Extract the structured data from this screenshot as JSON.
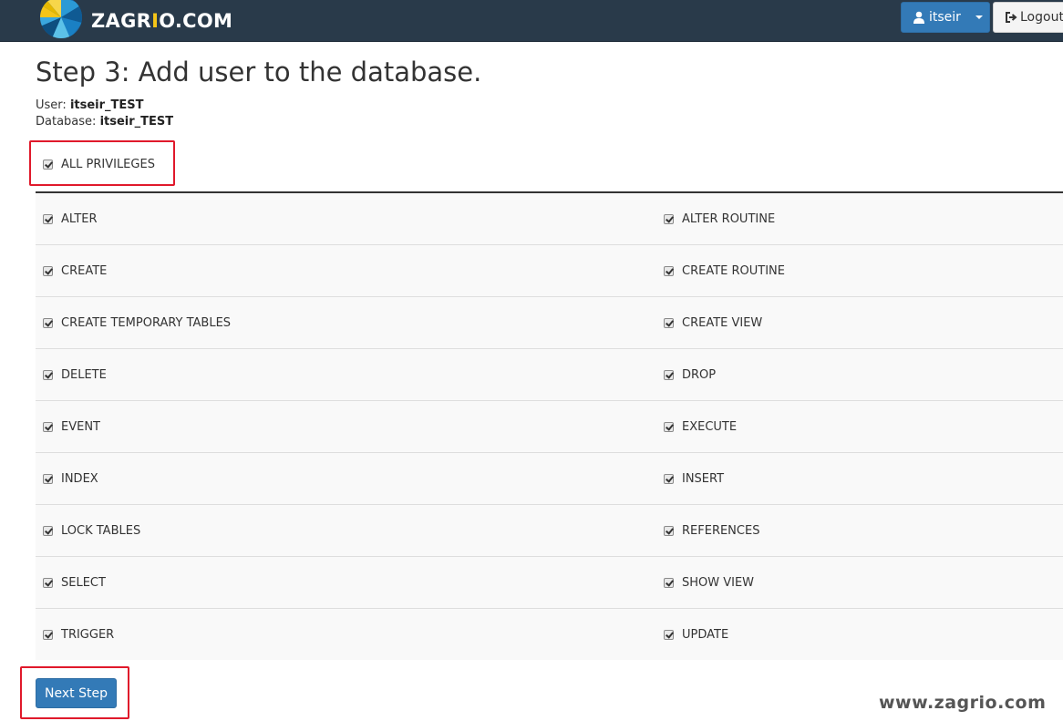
{
  "header": {
    "brand_prefix": "ZAGR",
    "brand_accent": "I",
    "brand_suffix": "O.COM",
    "user_label": "itseir",
    "logout_label": "Logout",
    "colors": {
      "navbar": "#293a4a",
      "primary": "#337ab7",
      "accent": "#f5c518"
    }
  },
  "main": {
    "title": "Step 3: Add user to the database.",
    "user_label": "User:",
    "user_value": "itseir_TEST",
    "database_label": "Database:",
    "database_value": "itseir_TEST",
    "all_privileges": {
      "label": "ALL PRIVILEGES",
      "checked": true
    },
    "privileges": [
      {
        "left": {
          "label": "ALTER",
          "checked": true
        },
        "right": {
          "label": "ALTER ROUTINE",
          "checked": true
        }
      },
      {
        "left": {
          "label": "CREATE",
          "checked": true
        },
        "right": {
          "label": "CREATE ROUTINE",
          "checked": true
        }
      },
      {
        "left": {
          "label": "CREATE TEMPORARY TABLES",
          "checked": true
        },
        "right": {
          "label": "CREATE VIEW",
          "checked": true
        }
      },
      {
        "left": {
          "label": "DELETE",
          "checked": true
        },
        "right": {
          "label": "DROP",
          "checked": true
        }
      },
      {
        "left": {
          "label": "EVENT",
          "checked": true
        },
        "right": {
          "label": "EXECUTE",
          "checked": true
        }
      },
      {
        "left": {
          "label": "INDEX",
          "checked": true
        },
        "right": {
          "label": "INSERT",
          "checked": true
        }
      },
      {
        "left": {
          "label": "LOCK TABLES",
          "checked": true
        },
        "right": {
          "label": "REFERENCES",
          "checked": true
        }
      },
      {
        "left": {
          "label": "SELECT",
          "checked": true
        },
        "right": {
          "label": "SHOW VIEW",
          "checked": true
        }
      },
      {
        "left": {
          "label": "TRIGGER",
          "checked": true
        },
        "right": {
          "label": "UPDATE",
          "checked": true
        }
      }
    ],
    "next_button": "Next Step",
    "highlight_color": "#e0192b"
  },
  "watermark": "www.zagrio.com"
}
